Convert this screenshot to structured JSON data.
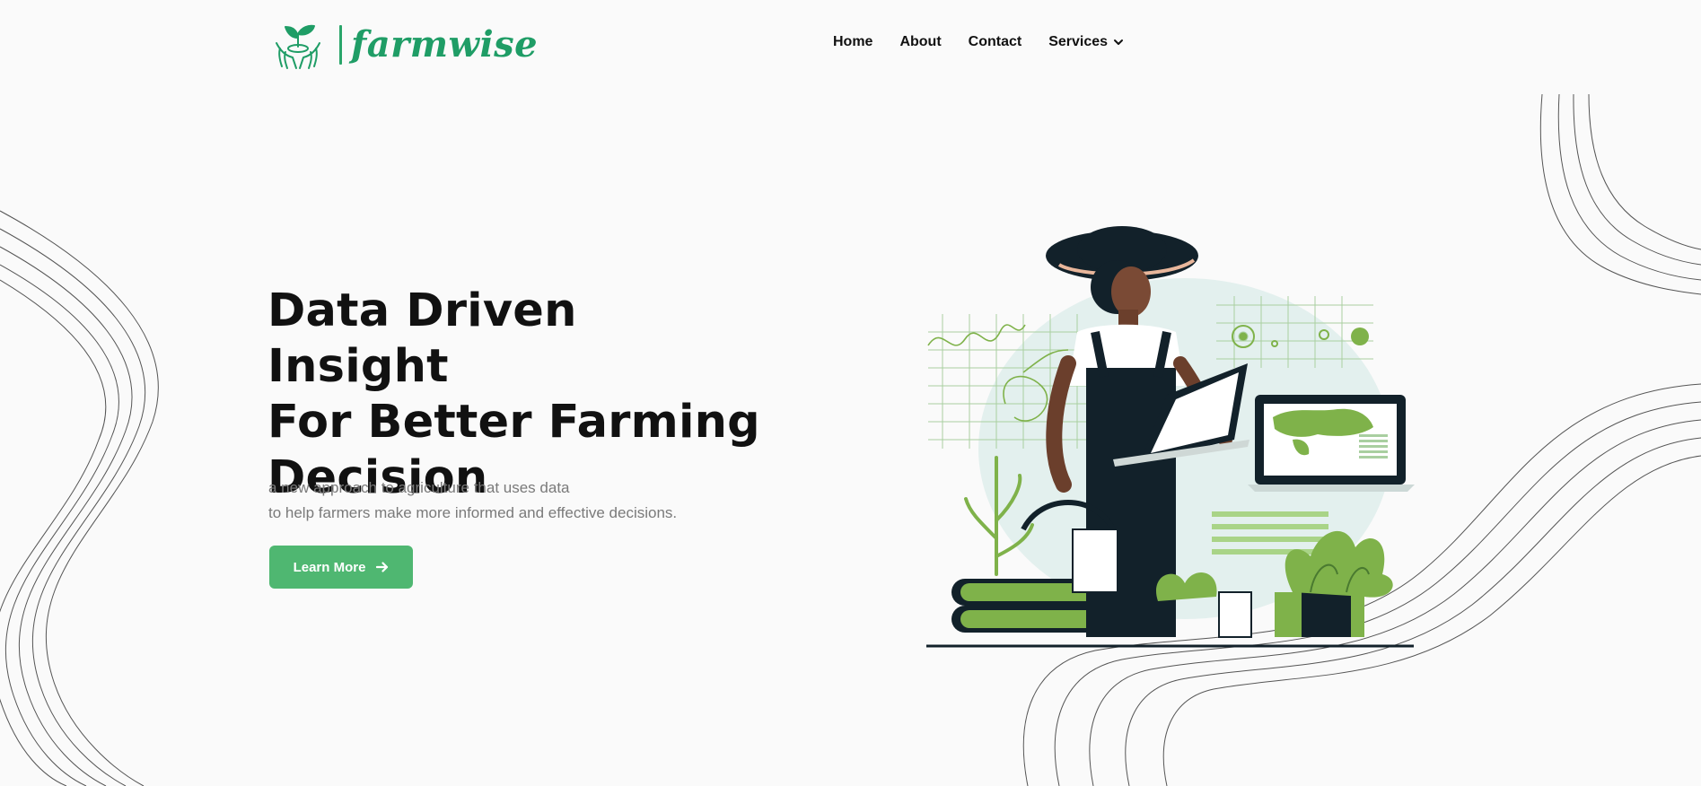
{
  "brand": {
    "name": "farmwise",
    "accent": "#1f9d66"
  },
  "nav": {
    "items": [
      {
        "label": "Home"
      },
      {
        "label": "About"
      },
      {
        "label": "Contact"
      },
      {
        "label": "Services",
        "icon": "chevron-down-icon"
      }
    ]
  },
  "hero": {
    "title_lines": [
      "Data Driven Insight",
      "For Better Farming",
      "Decision"
    ],
    "subtitle_lines": [
      "a new approach to agriculture that uses data",
      "to help farmers make more informed and effective decisions."
    ],
    "cta_label": "Learn More",
    "cta_icon": "arrow-right-icon",
    "cta_color": "#4fb771"
  },
  "illustration": {
    "subject": "farmer-with-laptop-illustration",
    "map_color": "#7fb24a"
  }
}
